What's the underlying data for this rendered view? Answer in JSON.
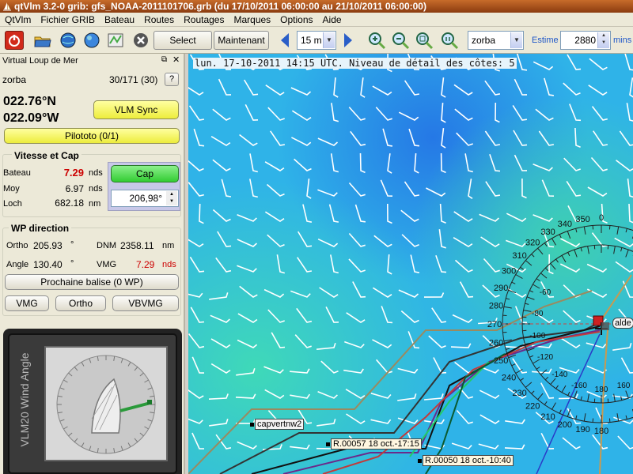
{
  "window": {
    "title": "qtVlm 3.2-0 grib: gfs_NOAA-2011101706.grb (du 17/10/2011 06:00:00 au 21/10/2011 06:00:00)"
  },
  "menu": {
    "items": [
      {
        "name": "menu-qtvlm",
        "label": "QtVlm"
      },
      {
        "name": "menu-fichier-grib",
        "label": "Fichier GRIB"
      },
      {
        "name": "menu-bateau",
        "label": "Bateau"
      },
      {
        "name": "menu-routes",
        "label": "Routes"
      },
      {
        "name": "menu-routages",
        "label": "Routages"
      },
      {
        "name": "menu-marques",
        "label": "Marques"
      },
      {
        "name": "menu-options",
        "label": "Options"
      },
      {
        "name": "menu-aide",
        "label": "Aide"
      }
    ]
  },
  "toolbar": {
    "select_label": "Select",
    "maintenant_label": "Maintenant",
    "step_value": "15 m",
    "boat_value": "zorba",
    "estime_label": "Estime",
    "estime_value": "2880",
    "estime_unit": "mins"
  },
  "panel": {
    "title": "Virtual Loup de Mer",
    "boat_name": "zorba",
    "rank": "30/171 (30)",
    "help_label": "?",
    "lat": "022.76°N",
    "lon": "022.09°W",
    "vlm_sync_label": "VLM Sync",
    "pilototo_label": "Pilototo (0/1)",
    "speed_group": {
      "title": "Vitesse et Cap",
      "bateau_label": "Bateau",
      "bateau_value": "7.29",
      "bateau_unit": "nds",
      "moy_label": "Moy",
      "moy_value": "6.97",
      "moy_unit": "nds",
      "loch_label": "Loch",
      "loch_value": "682.18",
      "loch_unit": "nm",
      "cap_label": "Cap",
      "cap_value": "206,98°"
    },
    "wp_group": {
      "title": "WP direction",
      "ortho_label": "Ortho",
      "ortho_value": "205.93",
      "ortho_unit": "°",
      "dnm_label": "DNM",
      "dnm_value": "2358.11",
      "dnm_unit": "nm",
      "angle_label": "Angle",
      "angle_value": "130.40",
      "angle_unit": "°",
      "vmg_label": "VMG",
      "vmg_value": "7.29",
      "vmg_unit": "nds",
      "next_wp_label": "Prochaine balise (0 WP)",
      "vmg_btn": "VMG",
      "ortho_btn": "Ortho",
      "vbvmg_btn": "VBVMG"
    },
    "instrument_label": "VLM20 Wind Angle"
  },
  "map": {
    "status_text": "lun. 17-10-2011 14:15 UTC. Niveau de détail des côtes: 5",
    "labels": {
      "capvert": "capvertnw2",
      "r57": "R.00057 18 oct.-17:15",
      "r50": "R.00050 18 oct.-10:40",
      "boat": "alde"
    },
    "compass_outer_labels": [
      "330",
      "340",
      "350",
      "0",
      "320",
      "310",
      "300",
      "290",
      "280",
      "270",
      "260",
      "250",
      "240",
      "230",
      "220",
      "210",
      "200",
      "190",
      "180"
    ],
    "compass_inner_labels": [
      "-80",
      "-60",
      "-100",
      "-120",
      "-140",
      "-160",
      "180",
      "160",
      "140",
      "120",
      "100"
    ],
    "colors": {
      "sea": "#2fb3e8",
      "sea_warm": "#3fd0b0",
      "sea_cool": "#2a8de8",
      "accent_red": "#cc0000",
      "button_yellow": "#eded3c",
      "cap_green": "#33cc33"
    }
  }
}
